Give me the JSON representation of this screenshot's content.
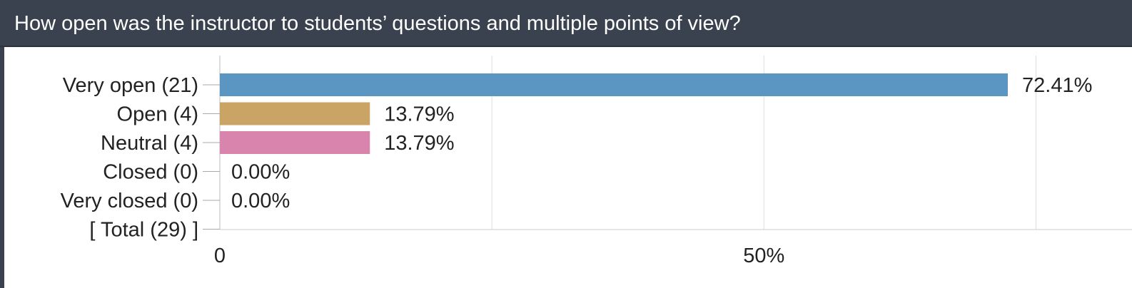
{
  "title": "How open was the instructor to students’ questions and multiple points of view?",
  "chart_data": {
    "type": "bar",
    "orientation": "horizontal",
    "title": "How open was the instructor to students’ questions and multiple points of view?",
    "categories": [
      "Very open (21)",
      "Open (4)",
      "Neutral (4)",
      "Closed (0)",
      "Very closed (0)",
      "[ Total (29) ]"
    ],
    "values": [
      72.41,
      13.79,
      13.79,
      0.0,
      0.0,
      null
    ],
    "value_labels": [
      "72.41%",
      "13.79%",
      "13.79%",
      "0.00%",
      "0.00%",
      ""
    ],
    "colors": [
      "#5b96c3",
      "#c9a465",
      "#d884ad",
      "#5b96c3",
      "#5b96c3",
      null
    ],
    "x_ticks": [
      {
        "value": 0,
        "label": "0"
      },
      {
        "value": 50,
        "label": "50%"
      }
    ],
    "x_gridlines": [
      0,
      25,
      50,
      75
    ],
    "xlim": [
      0,
      82
    ],
    "grid": true,
    "legend": "none"
  }
}
